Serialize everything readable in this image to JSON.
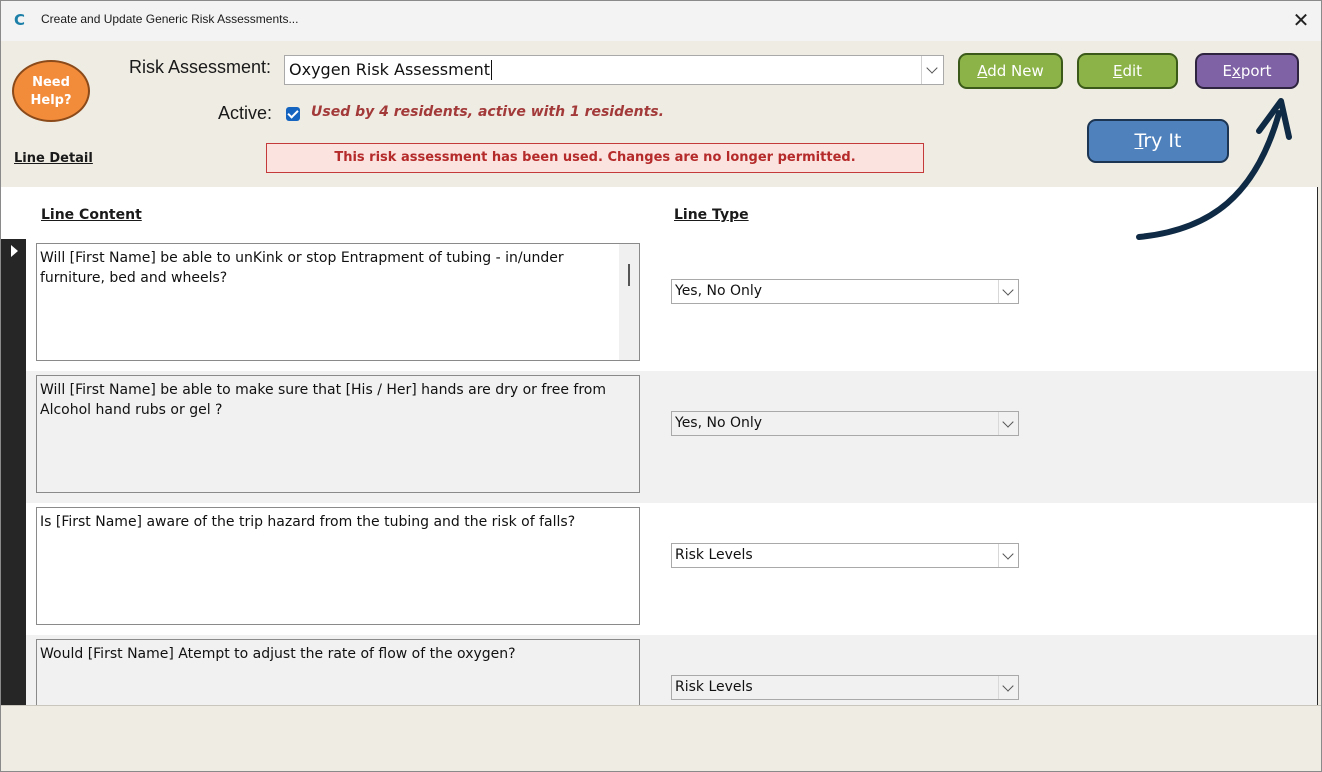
{
  "window": {
    "title": "Create and Update Generic Risk Assessments...",
    "app_icon_glyph": "C"
  },
  "header": {
    "help_label": "Need\nHelp?",
    "risk_assessment_label": "Risk Assessment:",
    "risk_assessment_value": "Oxygen Risk Assessment",
    "buttons": {
      "add_new": {
        "mnemonic": "A",
        "rest": "dd New"
      },
      "edit": {
        "mnemonic": "E",
        "rest": "dit"
      },
      "export": {
        "pre": "E",
        "mnemonic": "x",
        "rest": "port"
      },
      "try_it": {
        "mnemonic": "T",
        "rest": "ry It"
      }
    },
    "active_label": "Active:",
    "active_checked": true,
    "usage_text": "Used by 4 residents, active with 1 residents.",
    "line_detail_label": "Line Detail",
    "warning_text": "This risk assessment has been used.  Changes are no longer permitted."
  },
  "content": {
    "col_line_content": "Line Content",
    "col_line_type": "Line Type",
    "rows": [
      {
        "text": "Will [First Name] be able to unKink or stop Entrapment of tubing - in/under furniture, bed and wheels?",
        "type": "Yes, No Only"
      },
      {
        "text": "Will [First Name] be able to make sure that [His / Her] hands are dry or free from Alcohol hand rubs or gel ?",
        "type": "Yes, No Only"
      },
      {
        "text": "Is [First Name] aware of the trip hazard from the tubing and the risk of falls?",
        "type": "Risk Levels"
      },
      {
        "text": "Would [First Name] Atempt to adjust the rate of flow of the oxygen?",
        "type": "Risk Levels"
      }
    ]
  },
  "colors": {
    "accent_green": "#8cb348",
    "accent_purple": "#7f61a5",
    "accent_blue": "#4f81bd",
    "help_orange": "#f28b3a",
    "warning_red": "#b52a2a",
    "arrow": "#0f2a44"
  },
  "icons": {
    "close": "close-icon",
    "checkbox": "checkbox-checked-icon",
    "dropdown": "chevron-down-icon",
    "annotation_arrow": "curved-arrow-icon"
  }
}
